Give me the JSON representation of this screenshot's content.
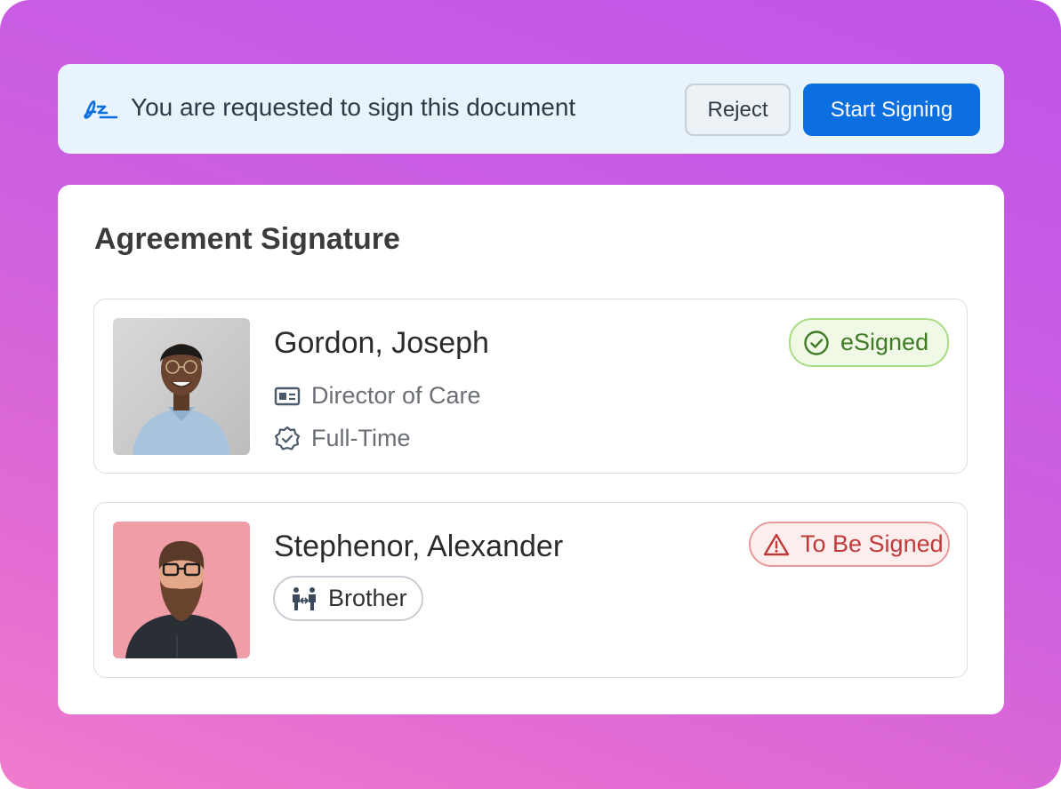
{
  "banner": {
    "message": "You are requested to sign this document",
    "reject_label": "Reject",
    "start_label": "Start Signing",
    "icon": "signature-icon"
  },
  "card": {
    "title": "Agreement Signature"
  },
  "signers": [
    {
      "name": "Gordon, Joseph",
      "role": "Director of Care",
      "employment": "Full-Time",
      "status": "eSigned",
      "status_color": "#3e7b24",
      "role_icon": "id-card-icon",
      "employment_icon": "verified-badge-icon",
      "status_icon": "check-circle-icon"
    },
    {
      "name": "Stephenor, Alexander",
      "relationship": "Brother",
      "status": "To Be Signed",
      "status_color": "#c03a3a",
      "relationship_icon": "family-icon",
      "status_icon": "warning-triangle-icon"
    }
  ],
  "colors": {
    "primary": "#0b6fe0",
    "banner_bg": "#e8f3fc",
    "gradient_start": "#c055e8",
    "gradient_end": "#f07ccd"
  }
}
